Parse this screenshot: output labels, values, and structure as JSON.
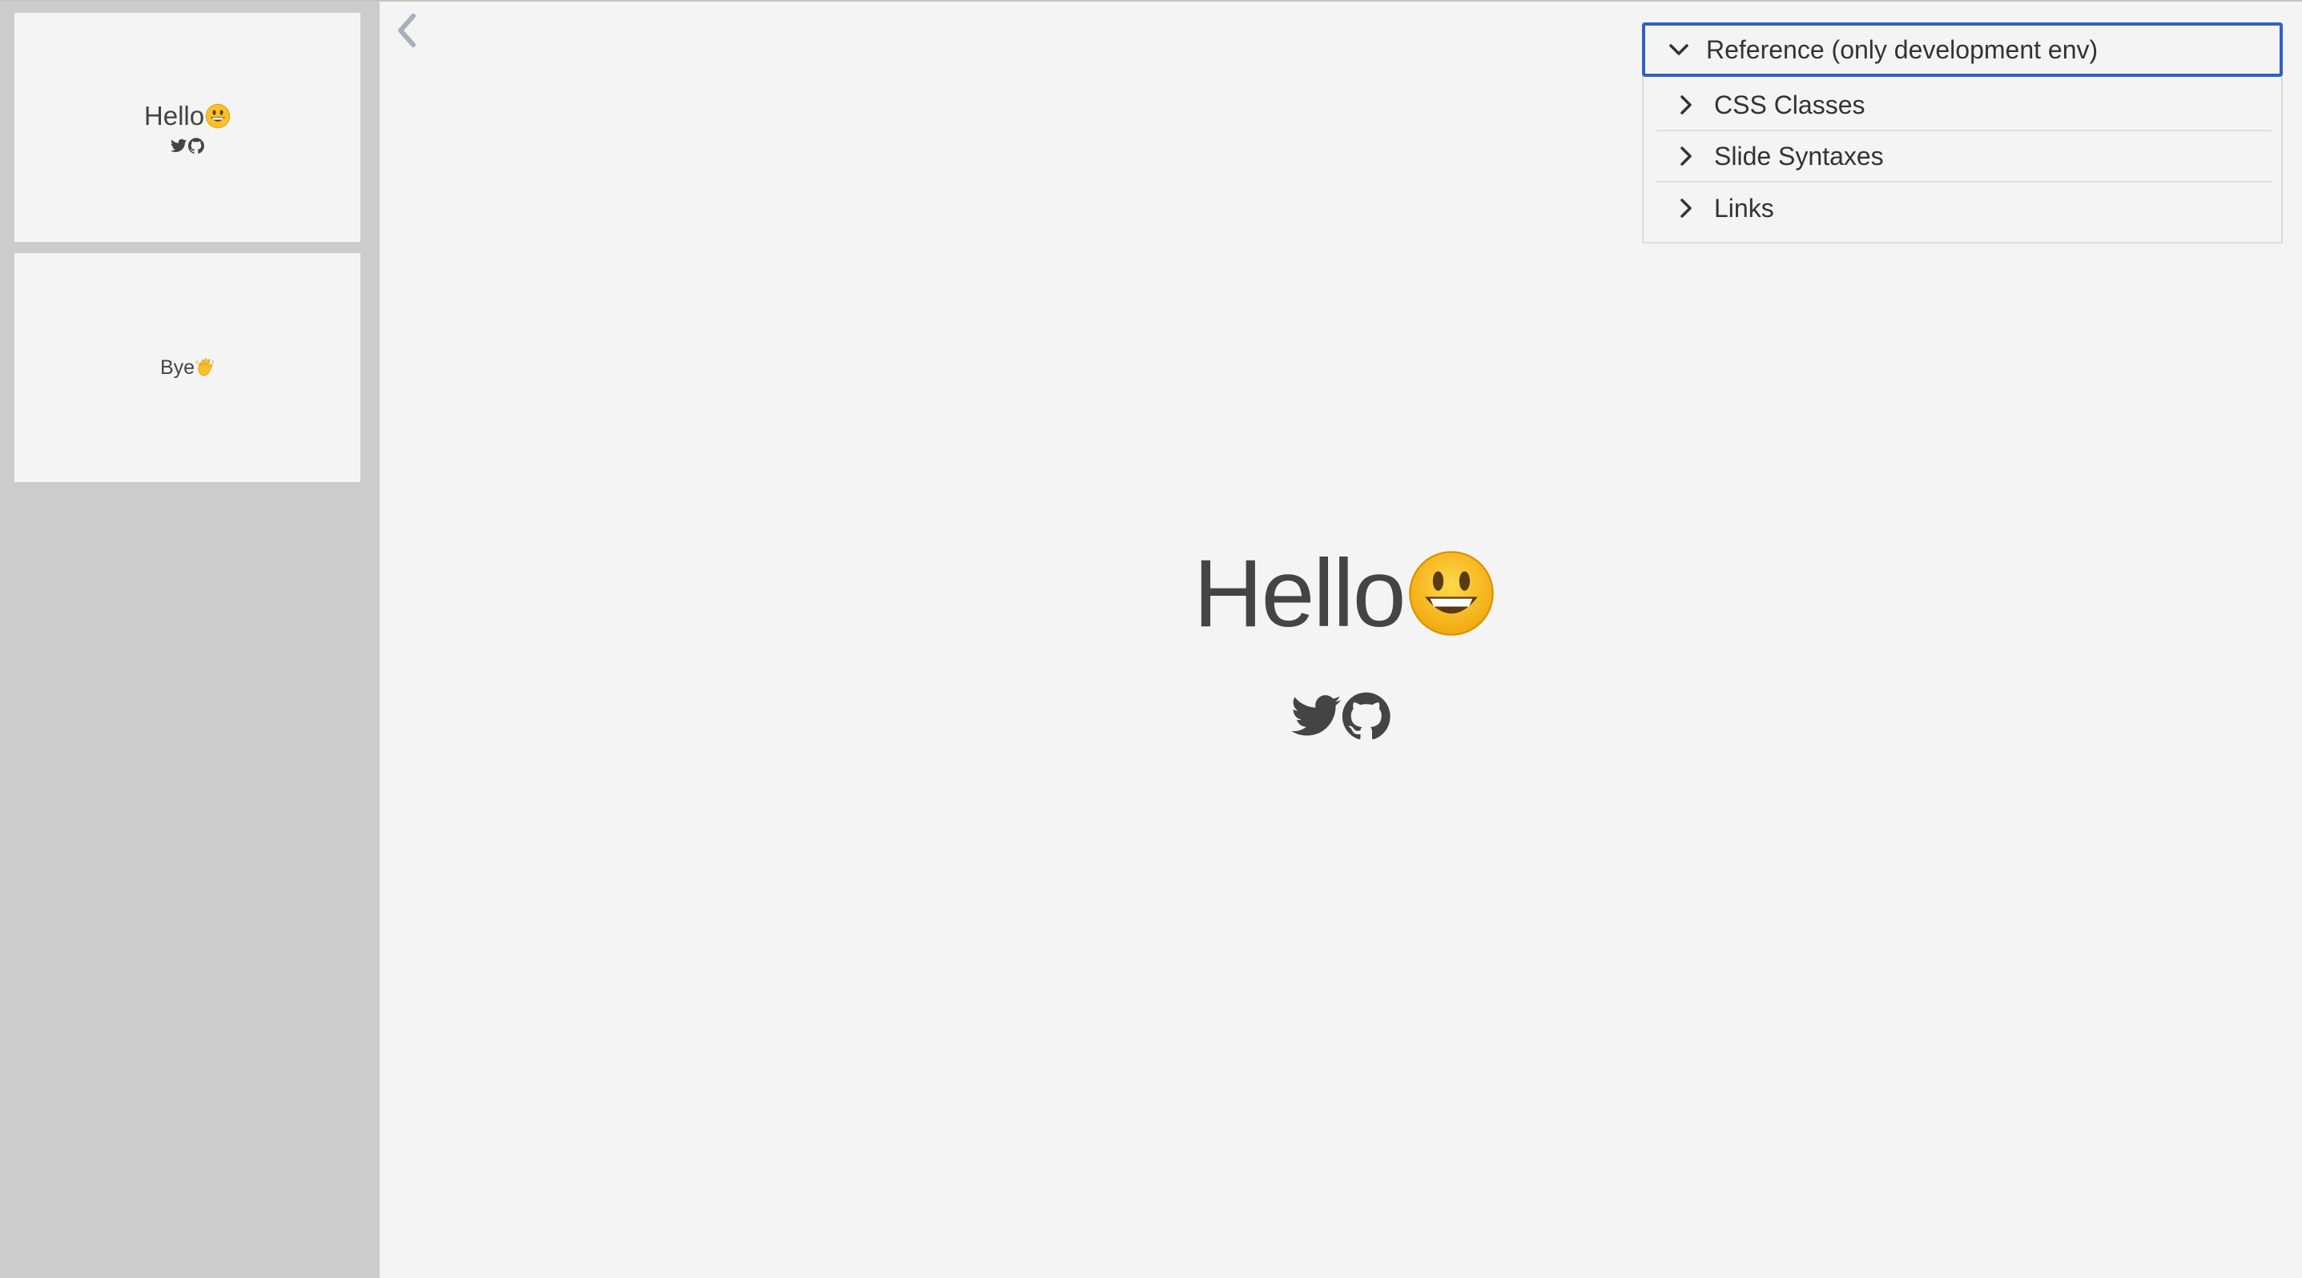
{
  "sidebar": {
    "thumbnails": [
      {
        "title": "Hello",
        "emoji": "smiley-face-emoji",
        "icons": [
          "twitter-icon",
          "github-icon"
        ]
      },
      {
        "title": "Bye",
        "emoji": "waving-hand-emoji"
      }
    ]
  },
  "reference": {
    "header_label": "Reference (only development env)",
    "items": [
      {
        "label": "CSS Classes"
      },
      {
        "label": "Slide Syntaxes"
      },
      {
        "label": "Links"
      }
    ]
  },
  "slide": {
    "title": "Hello",
    "emoji": "smiley-face-emoji",
    "icons": [
      "twitter-icon",
      "github-icon"
    ]
  },
  "colors": {
    "accent": "#2f62c4",
    "sidebar_bg": "#cccccc",
    "slide_bg": "#f4f4f4",
    "text": "#444444",
    "emoji_yellow": "#f7c12c"
  }
}
